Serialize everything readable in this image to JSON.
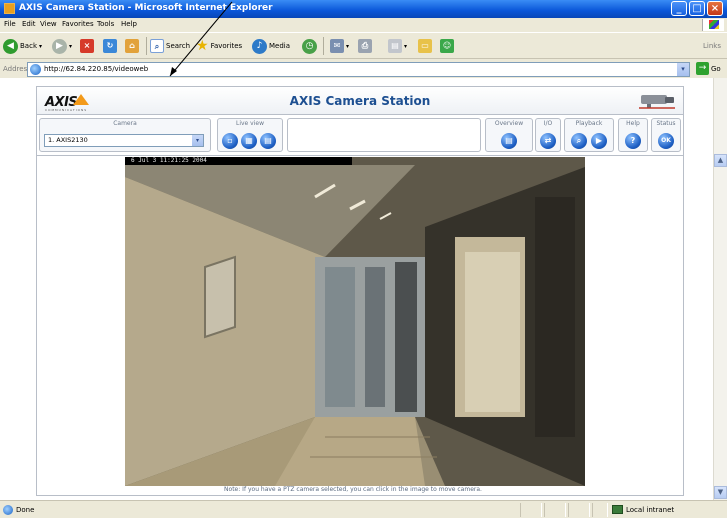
{
  "window": {
    "title": "AXIS Camera Station - Microsoft Internet Explorer",
    "buttons": [
      "minimize",
      "maximize",
      "close"
    ]
  },
  "menu": [
    "File",
    "Edit",
    "View",
    "Favorites",
    "Tools",
    "Help"
  ],
  "toolbar": {
    "back_label": "Back",
    "search_label": "Search",
    "favorites_label": "Favorites",
    "media_label": "Media",
    "links_label": "Links"
  },
  "address": {
    "label": "Address",
    "url": "http://62.84.220.85/videoweb",
    "go_label": "Go"
  },
  "app": {
    "logo": "AXIS",
    "logo_tagline": "COMMUNICATIONS",
    "title": "AXIS Camera Station",
    "camera_group_label": "Camera",
    "camera_selected": "1. AXIS2130",
    "liveview_label": "Live view",
    "overview_label": "Overview",
    "io_label": "I/O",
    "playback_label": "Playback",
    "help_label": "Help",
    "status_label": "Status",
    "timestamp": "6 Jul 3 11:21:25 2004",
    "note": "Note: If you have a PTZ camera selected, you can click in the image to move camera."
  },
  "status": {
    "text": "Done",
    "zone": "Local intranet"
  },
  "colors": {
    "titlebar": "#0a56d8",
    "chrome": "#ece9d8",
    "app_title": "#1d4f91",
    "axis_orange": "#f39a1a"
  }
}
